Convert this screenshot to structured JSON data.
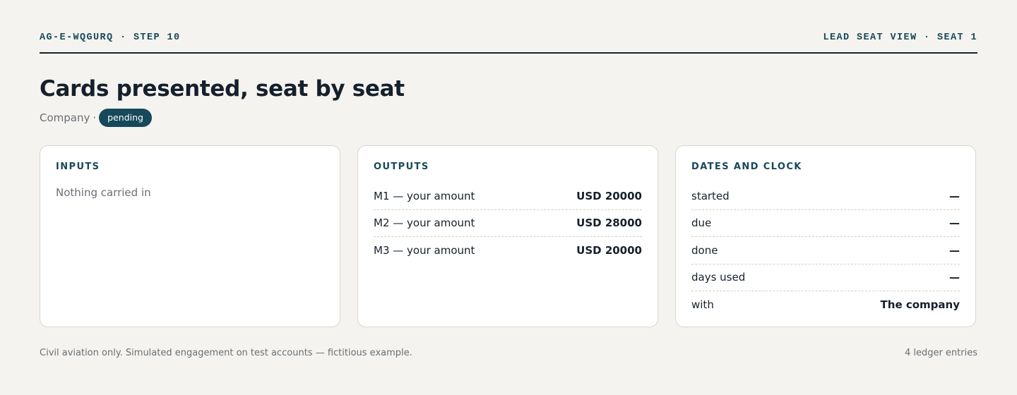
{
  "header": {
    "left": "AG-E-WQGURQ · STEP 10",
    "right": "LEAD SEAT VIEW · SEAT 1"
  },
  "title": "Cards presented, seat by seat",
  "subtitle": {
    "party": "Company",
    "separator": "·",
    "status": "pending"
  },
  "inputs": {
    "heading": "INPUTS",
    "empty": "Nothing carried in"
  },
  "outputs": {
    "heading": "OUTPUTS",
    "rows": [
      {
        "label": "M1 — your amount",
        "value": "USD 20000"
      },
      {
        "label": "M2 — your amount",
        "value": "USD 28000"
      },
      {
        "label": "M3 — your amount",
        "value": "USD 20000"
      }
    ]
  },
  "dates": {
    "heading": "DATES AND CLOCK",
    "rows": [
      {
        "label": "started",
        "value": "—"
      },
      {
        "label": "due",
        "value": "—"
      },
      {
        "label": "done",
        "value": "—"
      },
      {
        "label": "days used",
        "value": "—"
      },
      {
        "label": "with",
        "value": "The company"
      }
    ]
  },
  "footer": {
    "disclaimer": "Civil aviation only. Simulated engagement on test accounts — fictitious example.",
    "count": "4 ledger entries"
  }
}
